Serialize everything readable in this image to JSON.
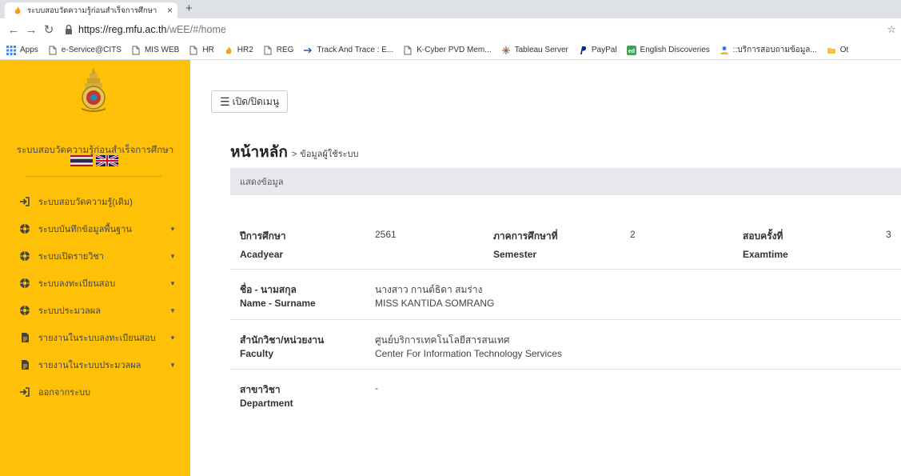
{
  "browser": {
    "tab_title": "ระบบสอบวัดความรู้ก่อนสำเร็จการศึกษา",
    "tab_close": "×",
    "new_tab": "+",
    "url_scheme_host": "https://reg.mfu.ac.th",
    "url_path": "/wEE/#/home",
    "bookmarks": [
      {
        "label": "Apps",
        "icon": "apps-grid-icon"
      },
      {
        "label": "e-Service@CITS",
        "icon": "page-icon"
      },
      {
        "label": "MIS WEB",
        "icon": "page-icon"
      },
      {
        "label": "HR",
        "icon": "page-icon"
      },
      {
        "label": "HR2",
        "icon": "flame-icon"
      },
      {
        "label": "REG",
        "icon": "page-icon"
      },
      {
        "label": "Track And Trace : E...",
        "icon": "arrow-icon"
      },
      {
        "label": "K-Cyber PVD Mem...",
        "icon": "page-icon"
      },
      {
        "label": "Tableau Server",
        "icon": "tableau-icon"
      },
      {
        "label": "PayPal",
        "icon": "paypal-icon"
      },
      {
        "label": "English Discoveries",
        "icon": "ed-icon"
      },
      {
        "label": "::บริการสอบถามข้อมูล...",
        "icon": "person-icon"
      },
      {
        "label": "Ot",
        "icon": "folder-icon"
      }
    ]
  },
  "sidebar": {
    "system_name": "ระบบสอบวัดความรู้ก่อนสำเร็จการศึกษา",
    "items": [
      {
        "label": "ระบบสอบวัดความรู้(เดิม)",
        "icon": "sign-out-icon",
        "has_submenu": false
      },
      {
        "label": "ระบบบันทึกข้อมูลพื้นฐาน",
        "icon": "settings-icon",
        "has_submenu": true
      },
      {
        "label": "ระบบเปิดรายวิชา",
        "icon": "settings-icon",
        "has_submenu": true
      },
      {
        "label": "ระบบลงทะเบียนสอบ",
        "icon": "settings-icon",
        "has_submenu": true
      },
      {
        "label": "ระบบประมวลผล",
        "icon": "settings-icon",
        "has_submenu": true
      },
      {
        "label": "รายงานในระบบลงทะเบียนสอบ",
        "icon": "file-icon",
        "has_submenu": true
      },
      {
        "label": "รายงานในระบบประมวลผล",
        "icon": "file-icon",
        "has_submenu": true
      },
      {
        "label": "ออกจากระบบ",
        "icon": "sign-out-icon",
        "has_submenu": false
      }
    ],
    "caret": "▼"
  },
  "main": {
    "toggle_icon": "☰",
    "toggle_label": "เปิด/ปิดเมนู",
    "title": "หน้าหลัก",
    "crumb_sep": ">",
    "crumb": "ข้อมูลผู้ใช้ระบบ",
    "panel_title": "แสดงข้อมูล",
    "info": {
      "acadyear_th": "ปีการศึกษา",
      "acadyear_en": "Acadyear",
      "acadyear_value": "2561",
      "semester_th": "ภาคการศึกษาที่",
      "semester_en": "Semester",
      "semester_value": "2",
      "examtime_th": "สอบครั้งที่",
      "examtime_en": "Examtime",
      "examtime_value": "3",
      "name_th": "ชื่อ - นามสกุล",
      "name_en": "Name - Surname",
      "name_value_th": "นางสาว กานต์ธิดา สมร่าง",
      "name_value_en": "MISS KANTIDA SOMRANG",
      "faculty_th": "สำนักวิชา/หน่วยงาน",
      "faculty_en": "Faculty",
      "faculty_value_th": "ศูนย์บริการเทคโนโลยีสารสนเทศ",
      "faculty_value_en": "Center For Information Technology Services",
      "dept_th": "สาขาวิชา",
      "dept_en": "Department",
      "dept_value": "-"
    }
  },
  "colors": {
    "sidebar_bg": "#ffc107",
    "panel_header_bg": "#e7e9ec"
  }
}
